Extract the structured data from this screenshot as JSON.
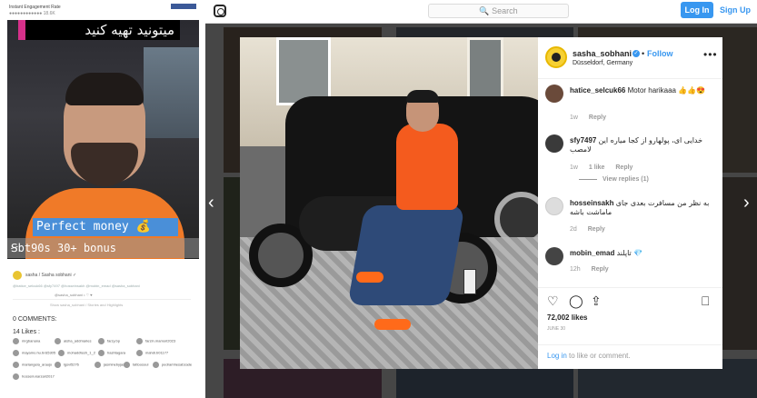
{
  "left_panel": {
    "header_title": "Instant Engagement Rate",
    "header_sub": "●●●●●●●●●●●● 18.6K",
    "overlay_persian": "میتونید تهیه کنید",
    "money_text": "Perfect money 💰",
    "bonus_text": "Ꞩbt90s 30+ bonus",
    "post_user": "sasha / Sasha sobhani ✓",
    "caption_tags": "@hatice_selcuk66 @sfy7497 @hosseinsakh @mobin_emad @sasha_sobhani",
    "mid_line": "@sasha_sobhani • ♡ ♥",
    "mid_line2": "Show sasha_sobhani / Stories and Highlights",
    "comments_label": "0 COMMENTS:",
    "likes_label": "14 Likes :",
    "likers": [
      "mrgbanana",
      "aisha_addmaries",
      "farzy.bp",
      "farzin.mamori2023",
      "mayamo.hu.br&5305",
      "mohaddtesh_1_2",
      "hashtagara",
      "mahdi.b01177",
      "mariangela_araujo",
      "lgsvl5276",
      "jasminebyjaspa",
      "tattoosoul",
      "pedramhesabzade",
      "hossein.karzari2017"
    ]
  },
  "navbar": {
    "search_placeholder": "🔍 Search",
    "login_label": "Log In",
    "signup_label": "Sign Up"
  },
  "modal": {
    "username": "sasha_sobhani",
    "verified_mark": "✓",
    "follow_label": "Follow",
    "location": "Düsseldorf, Germany",
    "more_label": "•••",
    "comments": [
      {
        "user": "hatice_selcuk66",
        "text": "Motor harikaaa 👍👍😍",
        "age": "1w",
        "likes": "",
        "reply": "Reply"
      },
      {
        "user": "sfy7497",
        "text": "خدایی ای، پولهارو از کجا میاره این لامصب",
        "age": "1w",
        "likes": "1 like",
        "reply": "Reply"
      },
      {
        "user": "hosseinsakh",
        "text": "به نظر من مسافرت بعدی جای ماماشت باشه",
        "age": "2d",
        "likes": "",
        "reply": "Reply"
      },
      {
        "user": "mobin_emad",
        "text": "تاپلند 💎",
        "age": "12h",
        "likes": "",
        "reply": "Reply"
      }
    ],
    "view_replies": "View replies (1)",
    "likes_count": "72,002 likes",
    "date": "JUNE 30",
    "login_link": "Log in",
    "login_rest": " to like or comment."
  }
}
